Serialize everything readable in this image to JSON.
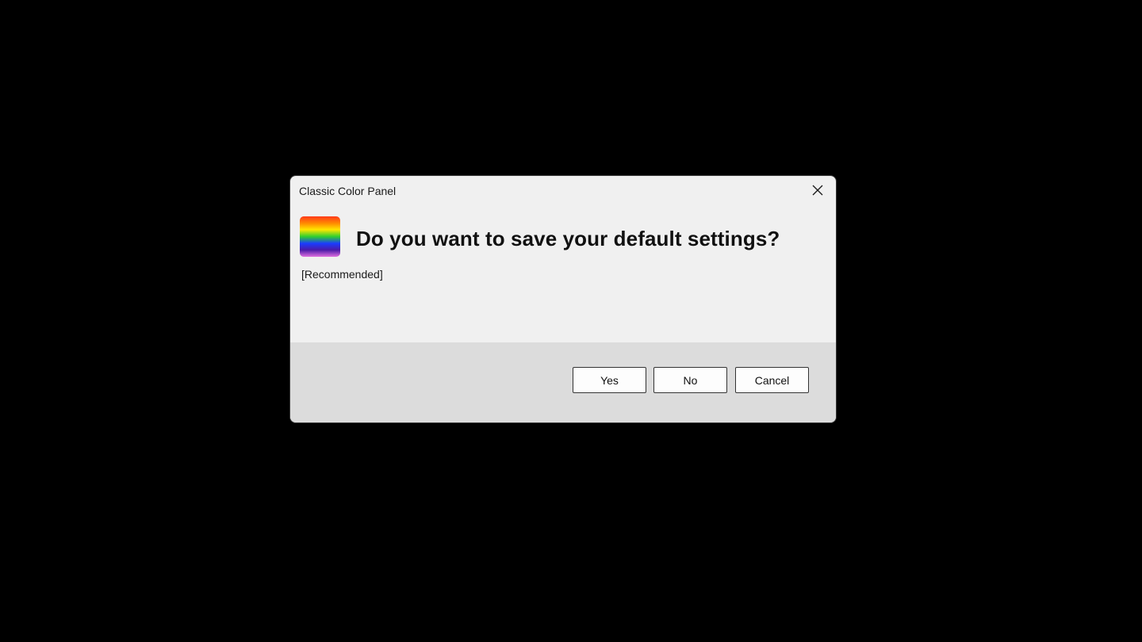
{
  "window": {
    "title": "Classic Color Panel",
    "close_icon": "close-icon"
  },
  "content": {
    "app_icon": "rainbow-gradient-icon",
    "heading": "Do you want to save your default settings?",
    "subtext": "[Recommended]"
  },
  "buttons": {
    "yes": "Yes",
    "no": "No",
    "cancel": "Cancel"
  },
  "colors": {
    "background": "#000000",
    "dialog": "#f0f0f0",
    "footer": "#dcdcdc",
    "button": "#fdfdfd",
    "button_border": "#333333"
  }
}
